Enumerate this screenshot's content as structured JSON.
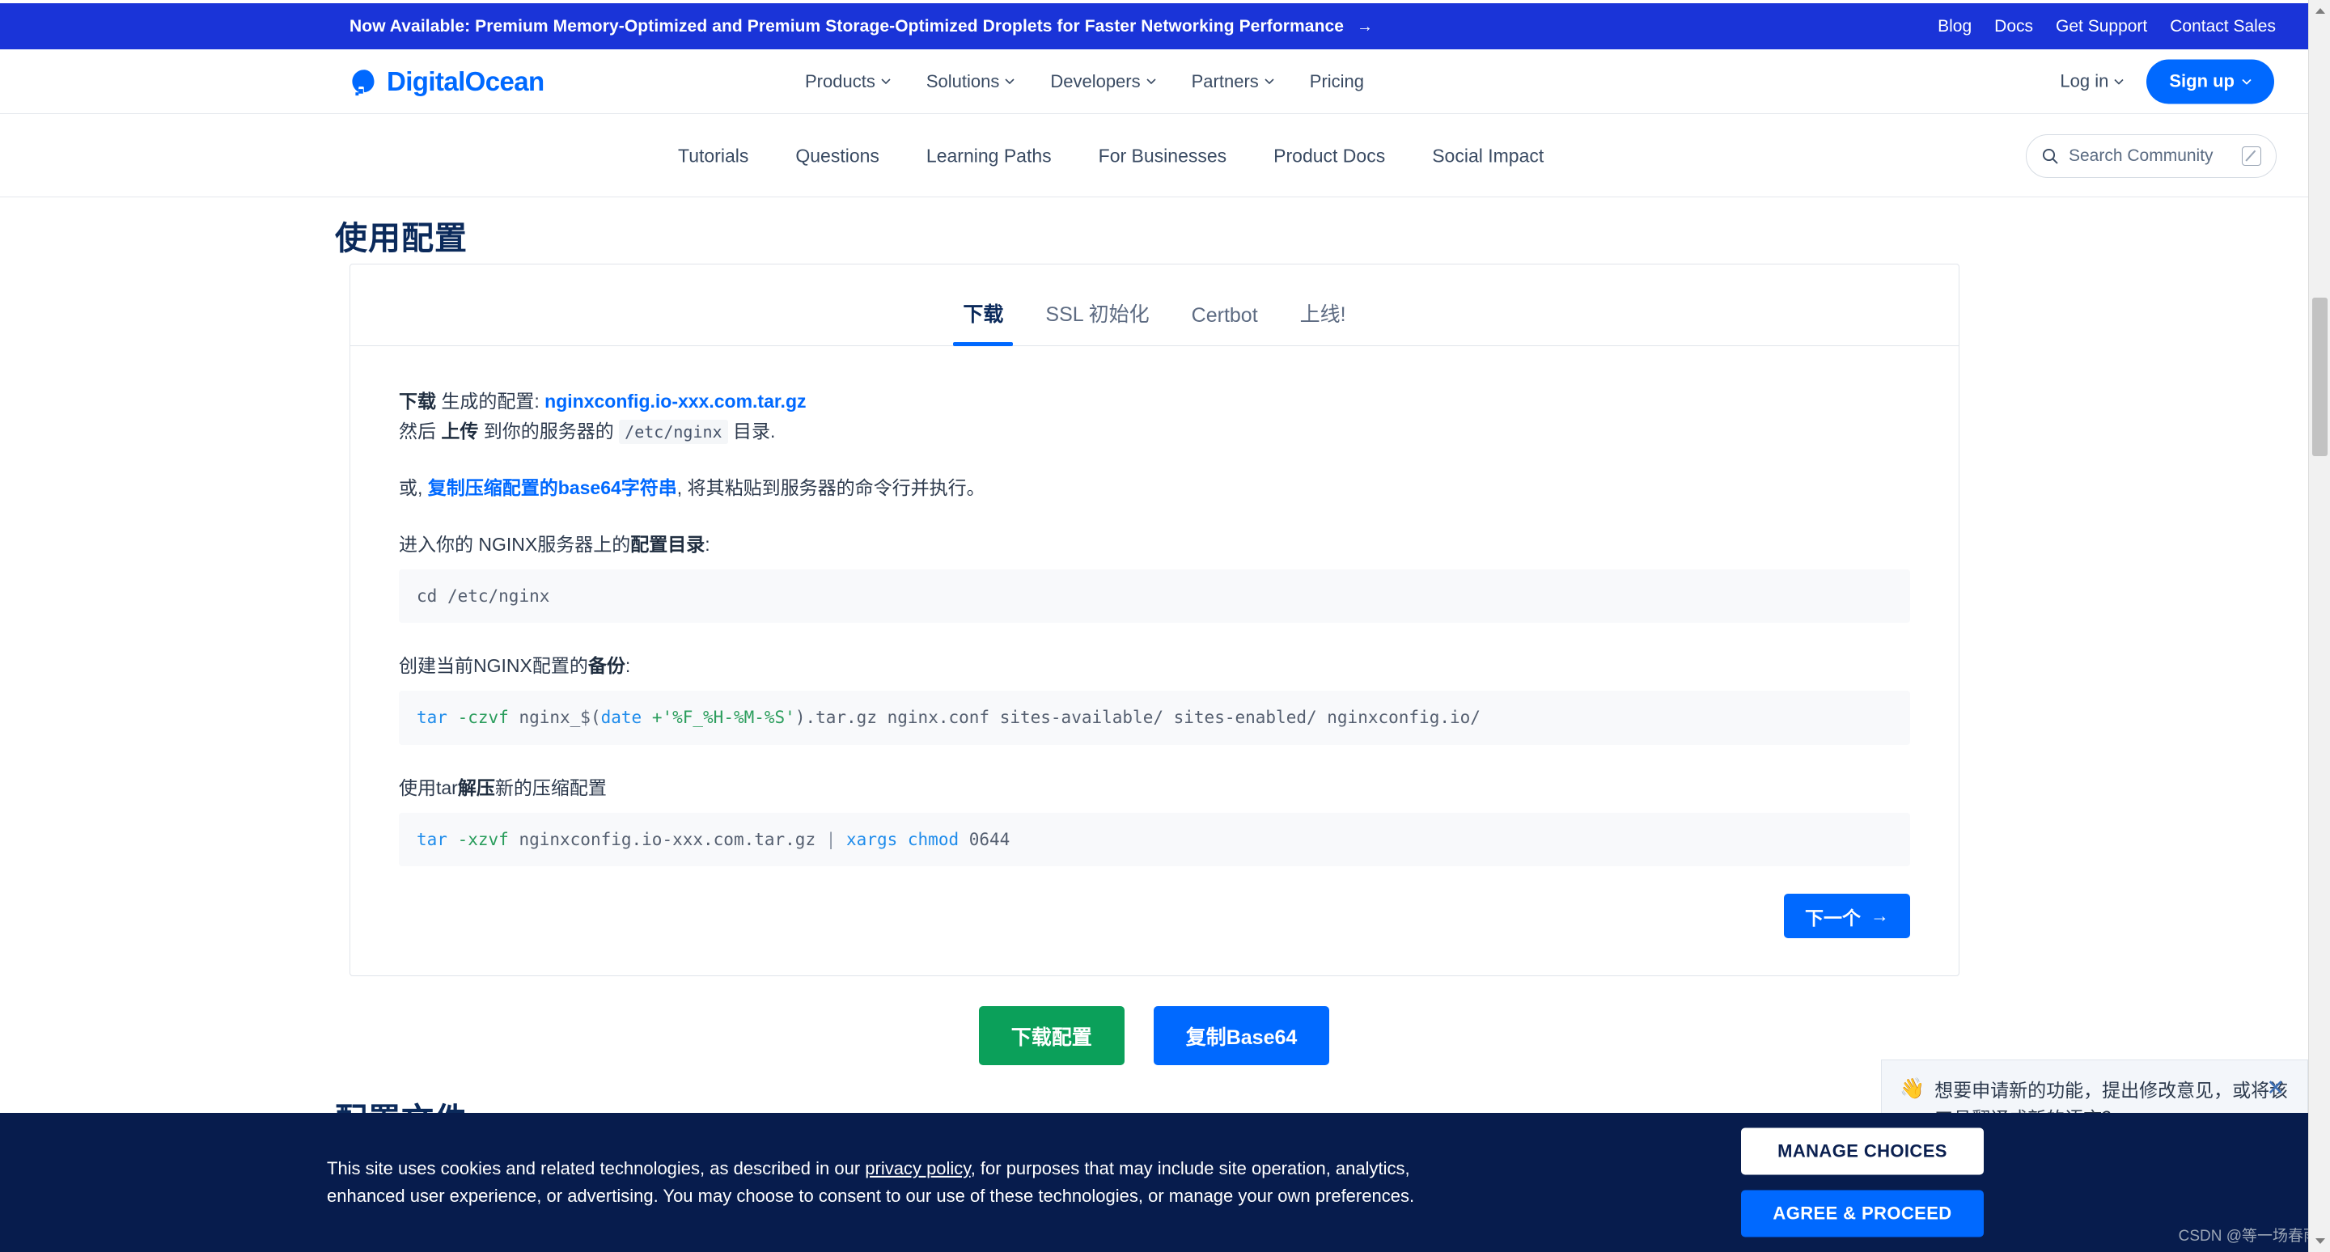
{
  "promo": {
    "message": "Now Available: Premium Memory-Optimized and Premium Storage-Optimized Droplets for Faster Networking Performance",
    "arrow": "→",
    "links": [
      "Blog",
      "Docs",
      "Get Support",
      "Contact Sales"
    ]
  },
  "header": {
    "brand": "DigitalOcean",
    "nav": [
      "Products",
      "Solutions",
      "Developers",
      "Partners",
      "Pricing"
    ],
    "login_label": "Log in",
    "signup_label": "Sign up"
  },
  "subnav": {
    "items": [
      "Tutorials",
      "Questions",
      "Learning Paths",
      "For Businesses",
      "Product Docs",
      "Social Impact"
    ],
    "search_placeholder": "Search Community"
  },
  "page": {
    "usage_title": "使用配置",
    "files_title": "配置文件"
  },
  "tabs": [
    {
      "label": "下载",
      "active": true
    },
    {
      "label": "SSL 初始化",
      "active": false
    },
    {
      "label": "Certbot",
      "active": false
    },
    {
      "label": "上线!",
      "active": false
    }
  ],
  "download_panel": {
    "line1_prefix": "下载",
    "line1_mid": " 生成的配置:  ",
    "line1_file": "nginxconfig.io-xxx.com.tar.gz",
    "line2_a": "然后 ",
    "line2_b": "上传",
    "line2_c": " 到你的服务器的 ",
    "line2_code": "/etc/nginx",
    "line2_d": " 目录.",
    "line3_a": "或, ",
    "line3_link": "复制压缩配置的base64字符串",
    "line3_b": ", 将其粘贴到服务器的命令行并执行。",
    "step1_label_a": "进入你的 NGINX服务器上的",
    "step1_label_b": "配置目录",
    "step1_label_c": ":",
    "step1_code": "cd /etc/nginx",
    "step1_code_tokens": [
      {
        "t": "cd",
        "c": "plain"
      },
      {
        "t": " /etc/nginx",
        "c": "plain"
      }
    ],
    "step2_label_a": "创建当前NGINX配置的",
    "step2_label_b": "备份",
    "step2_label_c": ":",
    "step2_code": "tar -czvf nginx_$(date +'%F_%H-%M-%S').tar.gz nginx.conf sites-available/ sites-enabled/ nginxconfig.io/",
    "step2_code_tokens": [
      {
        "t": "tar",
        "c": "cmd"
      },
      {
        "t": " -czvf",
        "c": "flag"
      },
      {
        "t": " nginx_$(",
        "c": "plain"
      },
      {
        "t": "date",
        "c": "fn"
      },
      {
        "t": " +'%F_%H-%M-%S'",
        "c": "str"
      },
      {
        "t": ").tar.gz nginx.conf sites-available/ sites-enabled/ nginxconfig.io/",
        "c": "plain"
      }
    ],
    "step3_label_a": "使用tar",
    "step3_label_b": "解压",
    "step3_label_c": "新的压缩配置",
    "step3_code": "tar -xzvf nginxconfig.io-xxx.com.tar.gz | xargs chmod 0644",
    "step3_code_tokens": [
      {
        "t": "tar",
        "c": "cmd"
      },
      {
        "t": " -xzvf",
        "c": "flag"
      },
      {
        "t": " nginxconfig.io-xxx.com.tar.gz ",
        "c": "plain"
      },
      {
        "t": "|",
        "c": "pipe"
      },
      {
        "t": " xargs",
        "c": "fn"
      },
      {
        "t": " chmod",
        "c": "fn"
      },
      {
        "t": " 0644",
        "c": "plain"
      }
    ],
    "next_label": "下一个",
    "next_arrow": "→"
  },
  "actions": {
    "download_config": "下载配置",
    "copy_base64": "复制Base64"
  },
  "feedback": {
    "emoji": "👋",
    "text": "想要申请新的功能，提出修改意见，或将该工具翻译成新的语言？",
    "close": "✕"
  },
  "cookie": {
    "text_a": "This site uses cookies and related technologies, as described in our ",
    "privacy_link": "privacy policy",
    "text_b": ", for purposes that may include site operation, analytics, enhanced user experience, or advertising. You may choose to consent to our use of these technologies, or manage your own preferences.",
    "manage_label": "MANAGE CHOICES",
    "agree_label": "AGREE & PROCEED"
  },
  "watermark": "CSDN @等一场春雨",
  "colors": {
    "promo_blue": "#1a34d8",
    "brand_blue": "#0069ff",
    "green": "#0ba05a",
    "navy": "#071c4d",
    "text": "#3a4b63"
  }
}
